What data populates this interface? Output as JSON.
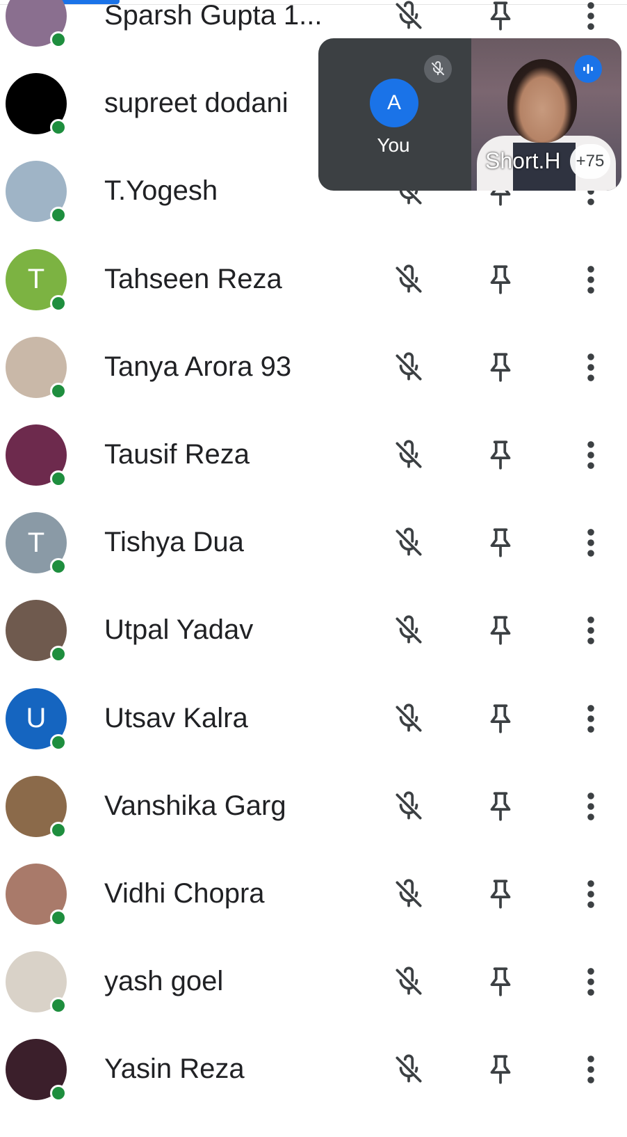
{
  "participants": [
    {
      "name": "Sparsh Gupta 1...",
      "initial": "",
      "avatar_color": "#8a6f8f"
    },
    {
      "name": "supreet dodani",
      "initial": "",
      "avatar_color": "#000000"
    },
    {
      "name": "T.Yogesh",
      "initial": "",
      "avatar_color": "#9fb4c6"
    },
    {
      "name": "Tahseen Reza",
      "initial": "T",
      "avatar_color": "#7cb342"
    },
    {
      "name": "Tanya Arora 93",
      "initial": "",
      "avatar_color": "#c9b8a8"
    },
    {
      "name": "Tausif Reza",
      "initial": "",
      "avatar_color": "#6d2a4d"
    },
    {
      "name": "Tishya Dua",
      "initial": "T",
      "avatar_color": "#8a9aa6"
    },
    {
      "name": "Utpal Yadav",
      "initial": "",
      "avatar_color": "#6f5a4e"
    },
    {
      "name": "Utsav Kalra",
      "initial": "U",
      "avatar_color": "#1565c0"
    },
    {
      "name": "Vanshika Garg",
      "initial": "",
      "avatar_color": "#8b6a4a"
    },
    {
      "name": "Vidhi Chopra",
      "initial": "",
      "avatar_color": "#a97a6a"
    },
    {
      "name": "yash goel",
      "initial": "",
      "avatar_color": "#d9d2c8"
    },
    {
      "name": "Yasin Reza",
      "initial": "",
      "avatar_color": "#3b1f2b"
    }
  ],
  "row_icons": {
    "mic": "mic-off-icon",
    "pin": "pin-icon",
    "more": "more-vert-icon"
  },
  "self_view": {
    "initial": "A",
    "label": "You",
    "mic_icon": "mic-off-icon"
  },
  "active_speaker": {
    "name": "Short.H",
    "extra_count": "+75",
    "speaking_icon": "audio-level-icon"
  },
  "colors": {
    "online": "#1e8e3e",
    "accent": "#1a73e8",
    "icon": "#3c4043"
  }
}
